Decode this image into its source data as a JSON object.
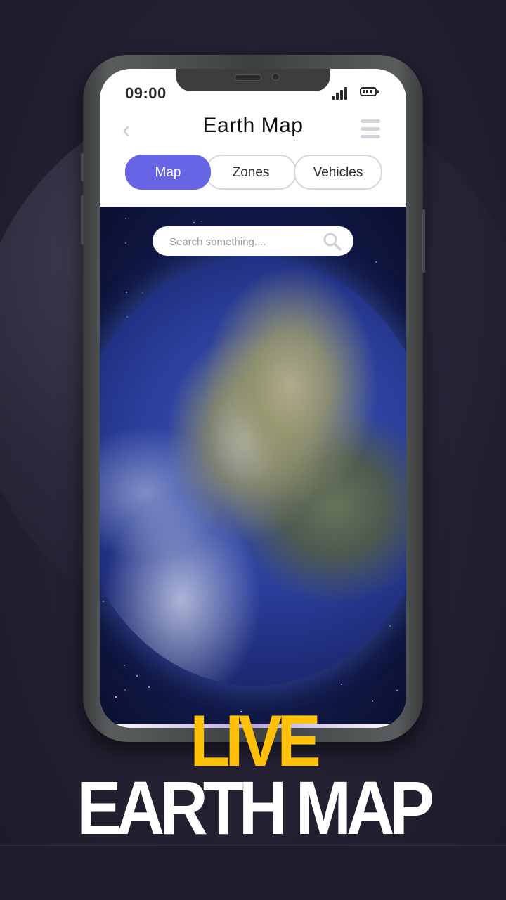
{
  "status_bar": {
    "time": "09:00",
    "signal_icon": "cellular-signal-icon",
    "battery_icon": "battery-icon"
  },
  "header": {
    "back_icon": "chevron-left-icon",
    "back_glyph": "‹",
    "title": "Earth Map",
    "menu_icon": "hamburger-menu-icon"
  },
  "tabs": [
    {
      "label": "Map",
      "active": true
    },
    {
      "label": "Zones",
      "active": false
    },
    {
      "label": "Vehicles",
      "active": false
    }
  ],
  "search": {
    "placeholder": "Search something....",
    "value": "",
    "icon": "search-icon"
  },
  "map": {
    "content": "earth-globe-view"
  },
  "promo": {
    "line1": "LIVE",
    "line2": "EARTH MAP",
    "line1_color": "#fec107",
    "line2_color": "#ffffff"
  },
  "colors": {
    "accent": "#6765e6",
    "background": "#262235"
  }
}
